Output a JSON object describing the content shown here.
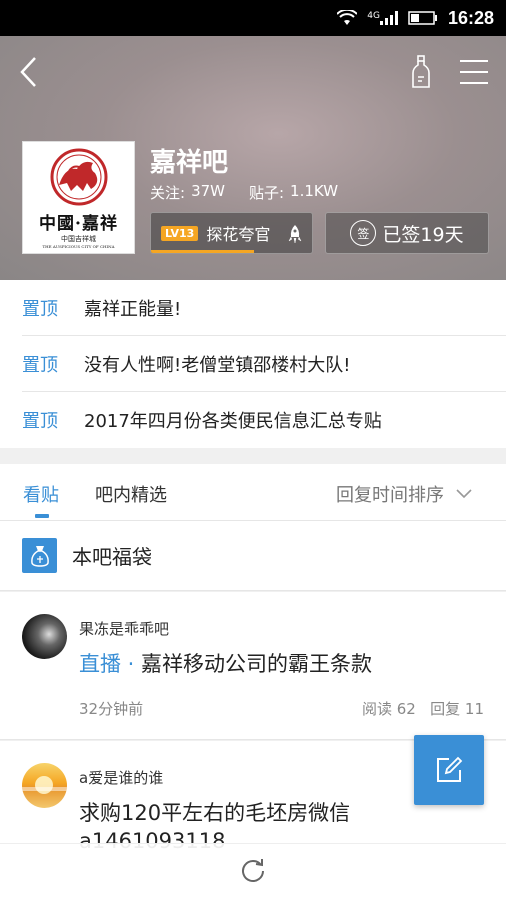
{
  "status_bar": {
    "network": "4G",
    "time": "16:28"
  },
  "forum": {
    "name": "嘉祥吧",
    "follow_label": "关注:",
    "follow_count": "37W",
    "posts_label": "贴子:",
    "posts_count": "1.1KW",
    "logo_text": "中國·嘉祥",
    "logo_sub": "中国吉祥城",
    "logo_sub_en": "THE AUSPICIOUS CITY OF CHINA",
    "level_badge": "LV13",
    "level_title": "探花夸官",
    "level_progress": 0.64,
    "sign_icon_text": "签",
    "sign_text": "已签19天"
  },
  "pinned": [
    {
      "tag": "置顶",
      "text": "嘉祥正能量!"
    },
    {
      "tag": "置顶",
      "text": "没有人性啊!老僧堂镇邵楼村大队!"
    },
    {
      "tag": "置顶",
      "text": "2017年四月份各类便民信息汇总专贴"
    }
  ],
  "tabs": {
    "posts": "看贴",
    "featured": "吧内精选",
    "sort": "回复时间排序"
  },
  "lucky_bag": {
    "label": "本吧福袋"
  },
  "posts": [
    {
      "author": "果冻是乖乖吧",
      "prefix": "直播",
      "title": "嘉祥移动公司的霸王条款",
      "time": "32分钟前",
      "reads": "阅读 62",
      "replies": "回复 11"
    },
    {
      "author": "a爱是谁的谁",
      "title": "求购120平左右的毛坯房微信",
      "title_line2": "a1461093118"
    }
  ],
  "colors": {
    "accent": "#3a8fd6",
    "level": "#f5a623"
  }
}
